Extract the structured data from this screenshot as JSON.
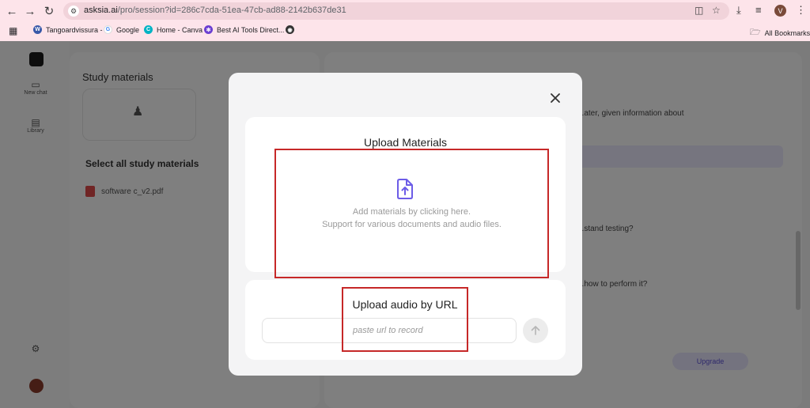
{
  "browser": {
    "url_host": "asksia.ai",
    "url_path": "/pro/session?id=286c7cda-51ea-47cb-ad88-2142b637de31",
    "profile_initial": "V",
    "bookmarks": [
      {
        "label": "Tangoardvissura -",
        "icon": "wordpress-icon",
        "color": "#3858a8"
      },
      {
        "label": "Google",
        "icon": "google-icon",
        "color": "#4285f4"
      },
      {
        "label": "Home - Canva",
        "icon": "canva-icon",
        "color": "#00b3c4"
      },
      {
        "label": "Best AI Tools Direct...",
        "icon": "ai-tools-icon",
        "color": "#6b3fd1"
      },
      {
        "label": "",
        "icon": "globe-icon",
        "color": "#333333"
      }
    ],
    "all_bookmarks": "All Bookmarks"
  },
  "background": {
    "rail": [
      "New chat",
      "Library"
    ],
    "study_title": "Study materials",
    "select_all": "Select all study materials",
    "file_name": "software c_v2.pdf",
    "lines": [
      "...ater, given information about",
      "...stand testing?",
      "...how to perform it?"
    ],
    "pill": "Upgrade"
  },
  "modal": {
    "upload_title": "Upload Materials",
    "drop_line1": "Add materials by clicking here.",
    "drop_line2": "Support for various documents and audio files.",
    "url_title": "Upload audio by URL",
    "url_placeholder": "paste url to record",
    "url_value": ""
  },
  "colors": {
    "accent": "#6c5ce7",
    "highlight_box": "#c62828",
    "chrome_bg": "#fde4ea"
  }
}
